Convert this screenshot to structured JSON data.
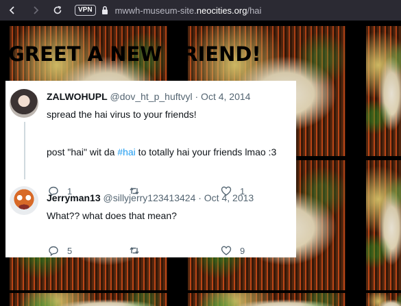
{
  "browser": {
    "url_prefix": "mwwh-museum-site.",
    "url_host": "neocities.org",
    "url_path": "/hai",
    "vpn_label": "VPN",
    "icons": [
      "back-icon",
      "forward-icon",
      "reload-icon",
      "lock-icon"
    ]
  },
  "page": {
    "banner": "GREET A NEW FRIEND!"
  },
  "tweets": [
    {
      "name": "ZALWOHUPL",
      "meta": "@dov_ht_p_huftvyl · Oct 4, 2014",
      "line1": "spread the hai virus to your friends!",
      "line2_before": "post \"hai\" wit da ",
      "line2_hashtag": "#hai",
      "line2_after": " to totally hai your friends lmao :3",
      "replies": "1",
      "retweets": "",
      "likes": "1"
    },
    {
      "name": "Jerryman13",
      "meta": "@sillyjerry123413424 · Oct 4, 2013",
      "line1": "What?? what does that mean?",
      "replies": "5",
      "retweets": "",
      "likes": "9"
    }
  ],
  "colors": {
    "chrome_bg": "#2b2a33",
    "hashtag": "#1d9bf0",
    "muted": "#536471"
  }
}
